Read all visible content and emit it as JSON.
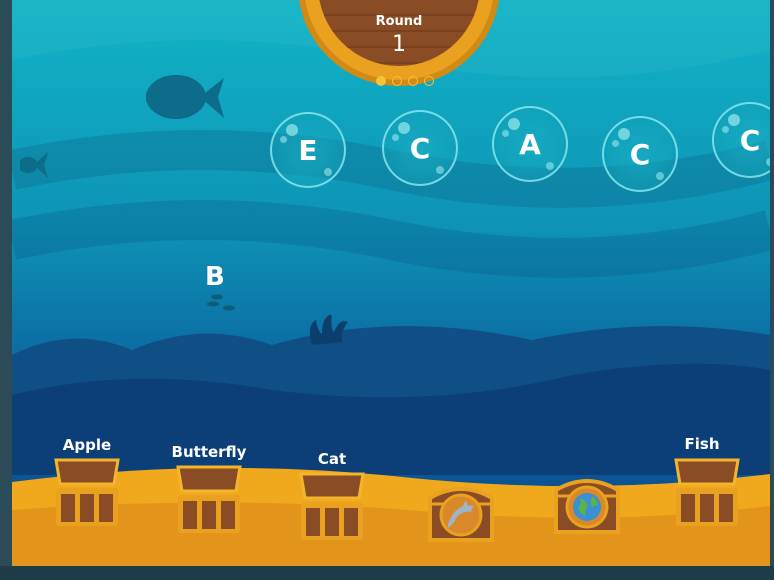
{
  "round": {
    "label": "Round",
    "number": "1",
    "progress_dots": 4,
    "current_dot": 1
  },
  "bubbles": [
    "E",
    "C",
    "A",
    "C",
    "C"
  ],
  "floating_letter": "B",
  "chests": [
    {
      "word": "Apple",
      "state": "open-empty"
    },
    {
      "word": "Butterfly",
      "state": "open-empty"
    },
    {
      "word": "Cat",
      "state": "open-empty"
    },
    {
      "word": "",
      "state": "closed",
      "icon": "dolphin-icon"
    },
    {
      "word": "",
      "state": "closed",
      "icon": "globe-icon"
    },
    {
      "word": "Fish",
      "state": "open-empty"
    }
  ],
  "colors": {
    "water_top": "#11b4c6",
    "water_bottom": "#0a4a8c",
    "sand": "#f0a81c",
    "chest_wood": "#8a4c24",
    "chest_gold": "#e9a11f"
  }
}
